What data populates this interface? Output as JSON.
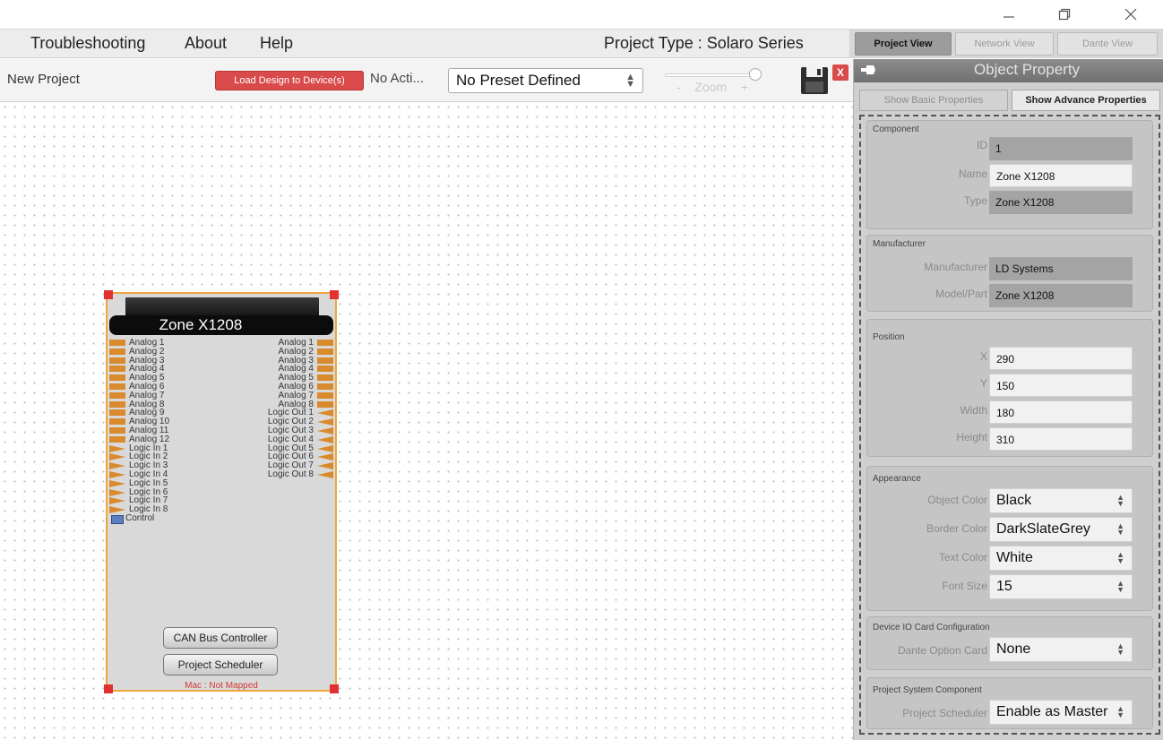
{
  "window": {
    "minimize_icon": "minimize-icon",
    "restore_icon": "restore-icon",
    "close_icon": "close-icon"
  },
  "menu": {
    "items": [
      "Troubleshooting",
      "About",
      "Help"
    ],
    "project_type": "Project Type : Solaro Series"
  },
  "view_tabs": [
    {
      "label": "Project View",
      "active": true
    },
    {
      "label": "Network View",
      "active": false
    },
    {
      "label": "Dante View",
      "active": false
    }
  ],
  "toolbar": {
    "project_name": "New Project",
    "load_button": "Load Design to Device(s)",
    "action_status": "No Acti...",
    "preset": "No Preset Defined",
    "zoom_minus": "-",
    "zoom_label": "Zoom",
    "zoom_plus": "+",
    "zoom_level": 0.95,
    "close_label": "X"
  },
  "device": {
    "title": "Zone X1208",
    "left_ports": [
      "Analog 1",
      "Analog 2",
      "Analog 3",
      "Analog 4",
      "Analog 5",
      "Analog 6",
      "Analog 7",
      "Analog 8",
      "Analog 9",
      "Analog 10",
      "Analog 11",
      "Analog 12",
      "Logic In 1",
      "Logic In 2",
      "Logic In 3",
      "Logic In 4",
      "Logic In 5",
      "Logic In 6",
      "Logic In 7",
      "Logic In 8"
    ],
    "right_ports": [
      "Analog 1",
      "Analog 2",
      "Analog 3",
      "Analog 4",
      "Analog 5",
      "Analog 6",
      "Analog 7",
      "Analog 8",
      "Logic Out 1",
      "Logic Out 2",
      "Logic Out 3",
      "Logic Out 4",
      "Logic Out 5",
      "Logic Out 6",
      "Logic Out 7",
      "Logic Out 8"
    ],
    "control": "Control",
    "buttons": [
      "CAN Bus Controller",
      "Project Scheduler"
    ],
    "mac": "Mac : Not Mapped"
  },
  "panel": {
    "title": "Object Property",
    "tabs": [
      {
        "label": "Show Basic Properties",
        "active": false
      },
      {
        "label": "Show Advance Properties",
        "active": true
      }
    ],
    "component": {
      "title": "Component",
      "id_label": "ID",
      "id": "1",
      "name_label": "Name",
      "name": "Zone X1208",
      "type_label": "Type",
      "type": "Zone X1208"
    },
    "manufacturer": {
      "title": "Manufacturer",
      "manufacturer_label": "Manufacturer",
      "manufacturer": "LD Systems",
      "model_label": "Model/Part",
      "model": "Zone X1208"
    },
    "position": {
      "title": "Position",
      "x_label": "X",
      "x": "290",
      "y_label": "Y",
      "y": "150",
      "width_label": "Width",
      "width": "180",
      "height_label": "Height",
      "height": "310"
    },
    "appearance": {
      "title": "Appearance",
      "object_color_label": "Object Color",
      "object_color": "Black",
      "border_color_label": "Border Color",
      "border_color": "DarkSlateGrey",
      "text_color_label": "Text Color",
      "text_color": "White",
      "font_size_label": "Font Size",
      "font_size": "15"
    },
    "io_card": {
      "title": "Device IO Card Configuration",
      "dante_label": "Dante Option Card",
      "dante": "None"
    },
    "system": {
      "title": "Project System Component",
      "scheduler_label": "Project Scheduler",
      "scheduler": "Enable as Master"
    }
  },
  "colors": {
    "load_button": "#d94a4a",
    "device_border": "#f0a440",
    "port_orange": "#d98a2c",
    "handle_red": "#e03030"
  }
}
